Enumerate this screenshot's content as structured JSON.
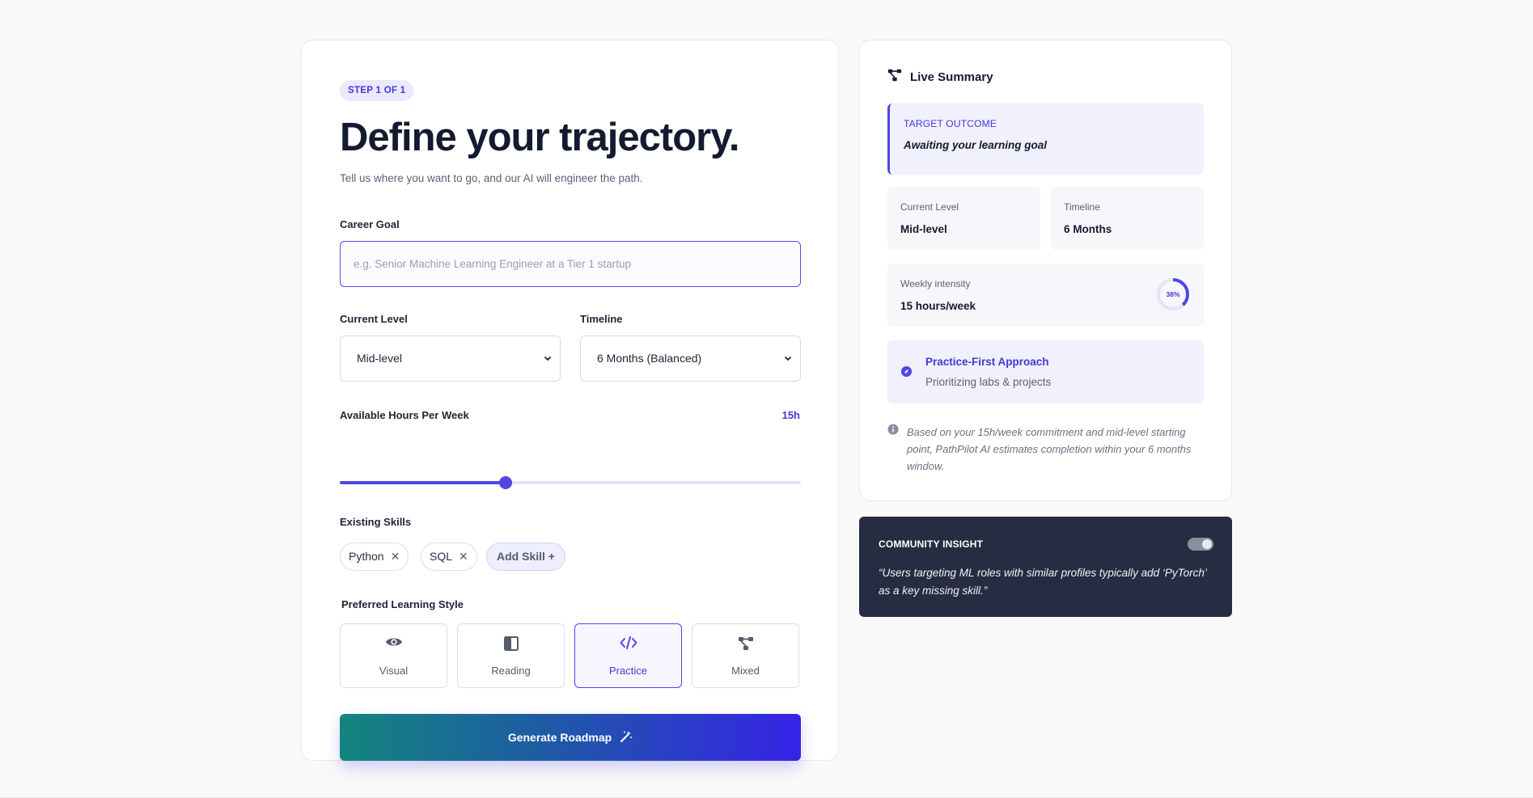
{
  "form": {
    "step_badge": "STEP 1 OF 1",
    "title": "Define your trajectory.",
    "subtitle": "Tell us where you want to go, and our AI will engineer the path.",
    "career_goal_label": "Career Goal",
    "career_goal_placeholder": "e.g. Senior Machine Learning Engineer at a Tier 1 startup",
    "career_goal_value": "",
    "current_level_label": "Current Level",
    "current_level_value": "Mid-level",
    "timeline_label": "Timeline",
    "timeline_value": "6 Months (Balanced)",
    "hours_label": "Available Hours Per Week",
    "hours_value": "15h",
    "hours_fraction": 0.36,
    "skills_label": "Existing Skills",
    "skills": [
      "Python",
      "SQL"
    ],
    "add_skill_label": "Add Skill +",
    "learning_style_label": "Preferred Learning Style",
    "learning_styles": [
      {
        "label": "Visual",
        "icon": "eye-icon",
        "active": false
      },
      {
        "label": "Reading",
        "icon": "book-icon",
        "active": false
      },
      {
        "label": "Practice",
        "icon": "code-icon",
        "active": true
      },
      {
        "label": "Mixed",
        "icon": "nodes-icon",
        "active": false
      }
    ],
    "generate_label": "Generate Roadmap"
  },
  "summary": {
    "title": "Live Summary",
    "target_outcome_label": "TARGET OUTCOME",
    "target_outcome_value": "Awaiting your learning goal",
    "current_level_label": "Current Level",
    "current_level_value": "Mid-level",
    "timeline_label": "Timeline",
    "timeline_value": "6 Months",
    "intensity_label": "Weekly intensity",
    "intensity_value": "15 hours/week",
    "intensity_percent": "38%",
    "intensity_fraction": 0.38,
    "approach_title": "Practice-First Approach",
    "approach_subtitle": "Prioritizing labs & projects",
    "note": "Based on your 15h/week commitment and mid-level starting point, PathPilot AI estimates completion within your 6 months window."
  },
  "community": {
    "label": "COMMUNITY INSIGHT",
    "quote": "“Users targeting ML roles with similar profiles typically add ‘PyTorch’ as a key missing skill.”",
    "toggle_on": true
  },
  "colors": {
    "accent": "#4f46e5",
    "accent_text": "#4437d6",
    "dark_card": "#262c41",
    "gradient_start": "#13857e",
    "gradient_end": "#3623e8"
  }
}
